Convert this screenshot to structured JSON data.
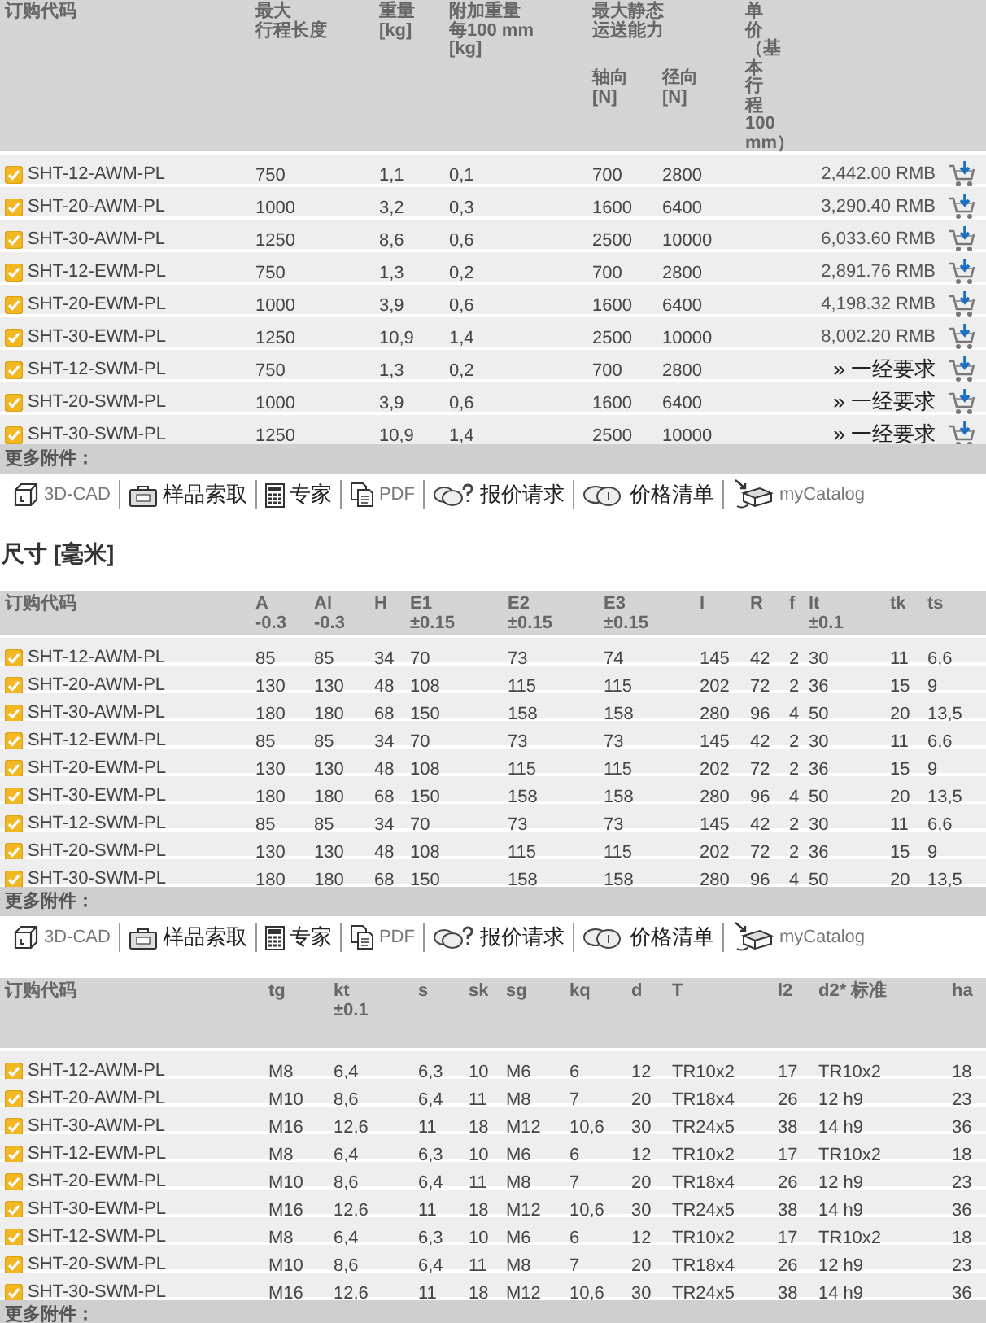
{
  "pricing": {
    "table": {
      "columns": [
        {
          "lines": [
            "订购代码"
          ]
        },
        {
          "lines": [
            "最大",
            "行程长度"
          ]
        },
        {
          "lines": [
            "重量",
            "[kg]"
          ]
        },
        {
          "lines": [
            "附加重量",
            "每100 mm",
            "[kg]"
          ]
        },
        {
          "lines": [
            "最大静态",
            "运送能力"
          ],
          "children": [
            {
              "lines": [
                "轴向",
                "[N]"
              ]
            },
            {
              "lines": [
                "径向",
                "[N]"
              ]
            }
          ]
        },
        {
          "lines": [
            "单",
            "价",
            "（基",
            "本",
            "行",
            "程",
            "100",
            "mm）"
          ]
        }
      ],
      "rows": [
        {
          "cells": [
            "SHT-12-AWM-PL",
            "750",
            "1,1",
            "0,1",
            "700",
            "2800"
          ],
          "price": {
            "kind": "amount",
            "text": "2,442.00 RMB"
          }
        },
        {
          "cells": [
            "SHT-20-AWM-PL",
            "1000",
            "3,2",
            "0,3",
            "1600",
            "6400"
          ],
          "price": {
            "kind": "amount",
            "text": "3,290.40 RMB"
          }
        },
        {
          "cells": [
            "SHT-30-AWM-PL",
            "1250",
            "8,6",
            "0,6",
            "2500",
            "10000"
          ],
          "price": {
            "kind": "amount",
            "text": "6,033.60 RMB"
          }
        },
        {
          "cells": [
            "SHT-12-EWM-PL",
            "750",
            "1,3",
            "0,2",
            "700",
            "2800"
          ],
          "price": {
            "kind": "amount",
            "text": "2,891.76 RMB"
          }
        },
        {
          "cells": [
            "SHT-20-EWM-PL",
            "1000",
            "3,9",
            "0,6",
            "1600",
            "6400"
          ],
          "price": {
            "kind": "amount",
            "text": "4,198.32 RMB"
          }
        },
        {
          "cells": [
            "SHT-30-EWM-PL",
            "1250",
            "10,9",
            "1,4",
            "2500",
            "10000"
          ],
          "price": {
            "kind": "amount",
            "text": "8,002.20 RMB"
          }
        },
        {
          "cells": [
            "SHT-12-SWM-PL",
            "750",
            "1,3",
            "0,2",
            "700",
            "2800"
          ],
          "price": {
            "kind": "request",
            "text": "» 一经要求"
          }
        },
        {
          "cells": [
            "SHT-20-SWM-PL",
            "1000",
            "3,9",
            "0,6",
            "1600",
            "6400"
          ],
          "price": {
            "kind": "request",
            "text": "» 一经要求"
          }
        },
        {
          "cells": [
            "SHT-30-SWM-PL",
            "1250",
            "10,9",
            "1,4",
            "2500",
            "10000"
          ],
          "price": {
            "kind": "request",
            "text": "» 一经要求"
          }
        }
      ]
    },
    "more_label": "更多附件：",
    "toolbar": [
      {
        "kind": "cad",
        "label": "3D-CAD"
      },
      {
        "kind": "sample",
        "label": "样品索取"
      },
      {
        "kind": "expert",
        "label": "专家"
      },
      {
        "kind": "pdf",
        "label": "PDF"
      },
      {
        "kind": "quote",
        "label": "报价请求"
      },
      {
        "kind": "pricelist",
        "label": "价格清单"
      },
      {
        "kind": "catalog",
        "label": "myCatalog"
      }
    ]
  },
  "dimensions": {
    "title": "尺寸 [毫米]",
    "table_1": {
      "columns": [
        "订购代码",
        "A\n-0.3",
        "Al\n-0.3",
        "H",
        "E1\n±0.15",
        "E2\n±0.15",
        "E3\n±0.15",
        "l",
        "R",
        "f",
        "lt\n±0.1",
        "tk",
        "ts"
      ],
      "rows": [
        {
          "cells": [
            "SHT-12-AWM-PL",
            "85",
            "85",
            "34",
            "70",
            "73",
            "74",
            "145",
            "42",
            "2",
            "30",
            "11",
            "6,6"
          ]
        },
        {
          "cells": [
            "SHT-20-AWM-PL",
            "130",
            "130",
            "48",
            "108",
            "115",
            "115",
            "202",
            "72",
            "2",
            "36",
            "15",
            "9"
          ]
        },
        {
          "cells": [
            "SHT-30-AWM-PL",
            "180",
            "180",
            "68",
            "150",
            "158",
            "158",
            "280",
            "96",
            "4",
            "50",
            "20",
            "13,5"
          ]
        },
        {
          "cells": [
            "SHT-12-EWM-PL",
            "85",
            "85",
            "34",
            "70",
            "73",
            "73",
            "145",
            "42",
            "2",
            "30",
            "11",
            "6,6"
          ]
        },
        {
          "cells": [
            "SHT-20-EWM-PL",
            "130",
            "130",
            "48",
            "108",
            "115",
            "115",
            "202",
            "72",
            "2",
            "36",
            "15",
            "9"
          ]
        },
        {
          "cells": [
            "SHT-30-EWM-PL",
            "180",
            "180",
            "68",
            "150",
            "158",
            "158",
            "280",
            "96",
            "4",
            "50",
            "20",
            "13,5"
          ]
        },
        {
          "cells": [
            "SHT-12-SWM-PL",
            "85",
            "85",
            "34",
            "70",
            "73",
            "73",
            "145",
            "42",
            "2",
            "30",
            "11",
            "6,6"
          ]
        },
        {
          "cells": [
            "SHT-20-SWM-PL",
            "130",
            "130",
            "48",
            "108",
            "115",
            "115",
            "202",
            "72",
            "2",
            "36",
            "15",
            "9"
          ]
        },
        {
          "cells": [
            "SHT-30-SWM-PL",
            "180",
            "180",
            "68",
            "150",
            "158",
            "158",
            "280",
            "96",
            "4",
            "50",
            "20",
            "13,5"
          ]
        }
      ]
    },
    "more_label_1": "更多附件：",
    "toolbar": [
      {
        "kind": "cad",
        "label": "3D-CAD"
      },
      {
        "kind": "sample",
        "label": "样品索取"
      },
      {
        "kind": "expert",
        "label": "专家"
      },
      {
        "kind": "pdf",
        "label": "PDF"
      },
      {
        "kind": "quote",
        "label": "报价请求"
      },
      {
        "kind": "pricelist",
        "label": "价格清单"
      },
      {
        "kind": "catalog",
        "label": "myCatalog"
      }
    ],
    "table_2": {
      "columns": [
        "订购代码",
        "tg",
        "kt\n±0.1",
        "s",
        "sk",
        "sg",
        "kq",
        "d",
        "T",
        "l2",
        "d2* 标准",
        "ha"
      ],
      "rows": [
        {
          "cells": [
            "SHT-12-AWM-PL",
            "M8",
            "6,4",
            "6,3",
            "10",
            "M6",
            "6",
            "12",
            "TR10x2",
            "17",
            "TR10x2",
            "18"
          ]
        },
        {
          "cells": [
            "SHT-20-AWM-PL",
            "M10",
            "8,6",
            "6,4",
            "11",
            "M8",
            "7",
            "20",
            "TR18x4",
            "26",
            "12 h9",
            "23"
          ]
        },
        {
          "cells": [
            "SHT-30-AWM-PL",
            "M16",
            "12,6",
            "11",
            "18",
            "M12",
            "10,6",
            "30",
            "TR24x5",
            "38",
            "14 h9",
            "36"
          ]
        },
        {
          "cells": [
            "SHT-12-EWM-PL",
            "M8",
            "6,4",
            "6,3",
            "10",
            "M6",
            "6",
            "12",
            "TR10x2",
            "17",
            "TR10x2",
            "18"
          ]
        },
        {
          "cells": [
            "SHT-20-EWM-PL",
            "M10",
            "8,6",
            "6,4",
            "11",
            "M8",
            "7",
            "20",
            "TR18x4",
            "26",
            "12 h9",
            "23"
          ]
        },
        {
          "cells": [
            "SHT-30-EWM-PL",
            "M16",
            "12,6",
            "11",
            "18",
            "M12",
            "10,6",
            "30",
            "TR24x5",
            "38",
            "14 h9",
            "36"
          ]
        },
        {
          "cells": [
            "SHT-12-SWM-PL",
            "M8",
            "6,4",
            "6,3",
            "10",
            "M6",
            "6",
            "12",
            "TR10x2",
            "17",
            "TR10x2",
            "18"
          ]
        },
        {
          "cells": [
            "SHT-20-SWM-PL",
            "M10",
            "8,6",
            "6,4",
            "11",
            "M8",
            "7",
            "20",
            "TR18x4",
            "26",
            "12 h9",
            "23"
          ]
        },
        {
          "cells": [
            "SHT-30-SWM-PL",
            "M16",
            "12,6",
            "11",
            "18",
            "M12",
            "10,6",
            "30",
            "TR24x5",
            "38",
            "14 h9",
            "36"
          ]
        }
      ]
    },
    "more_label_2": "更多附件："
  }
}
